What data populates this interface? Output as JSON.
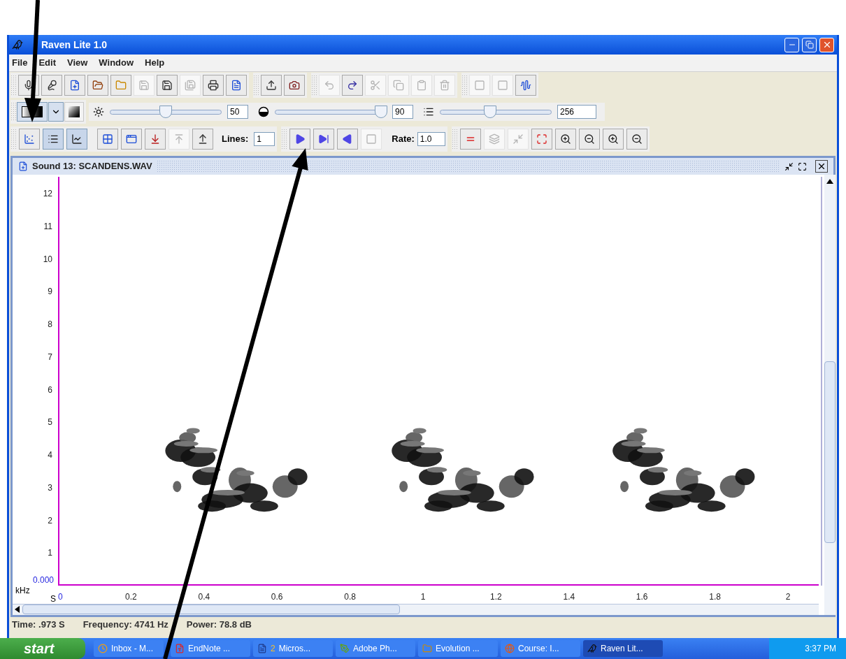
{
  "window": {
    "title": "Raven Lite 1.0"
  },
  "menu": [
    {
      "label": "File"
    },
    {
      "label": "Edit"
    },
    {
      "label": "View"
    },
    {
      "label": "Window"
    },
    {
      "label": "Help"
    }
  ],
  "file_toolbar": [
    [
      {
        "kind": "mic",
        "disabled": false
      },
      {
        "kind": "mics",
        "disabled": false
      },
      {
        "kind": "new",
        "disabled": false
      },
      {
        "kind": "open",
        "disabled": false
      },
      {
        "kind": "folder",
        "disabled": false
      },
      {
        "kind": "save",
        "disabled": true
      },
      {
        "kind": "saveas",
        "disabled": false
      },
      {
        "kind": "saveall",
        "disabled": true
      },
      {
        "kind": "print",
        "disabled": false
      },
      {
        "kind": "page",
        "disabled": false
      }
    ],
    [
      {
        "kind": "export",
        "disabled": false
      },
      {
        "kind": "snapshot",
        "disabled": false
      }
    ],
    [
      {
        "kind": "undo",
        "disabled": true
      },
      {
        "kind": "redo",
        "disabled": false
      },
      {
        "kind": "cut",
        "disabled": true
      },
      {
        "kind": "copy",
        "disabled": true
      },
      {
        "kind": "paste",
        "disabled": true
      },
      {
        "kind": "delete",
        "disabled": true
      }
    ],
    [
      {
        "kind": "square",
        "disabled": true
      },
      {
        "kind": "square",
        "disabled": true
      },
      {
        "kind": "wave",
        "disabled": false
      }
    ]
  ],
  "display_toolbar": {
    "sliders": [
      {
        "kind": "brightness",
        "level": 0.5,
        "value": "50"
      },
      {
        "kind": "contrast",
        "level": 0.95,
        "value": "90"
      },
      {
        "kind": "size",
        "level": 0.45,
        "value": "256"
      }
    ]
  },
  "view_toolbar": {
    "views": [
      {
        "kind": "spectrogram",
        "selected": false
      },
      {
        "kind": "lines",
        "selected": true
      },
      {
        "kind": "axis",
        "selected": true
      }
    ],
    "layout": [
      {
        "kind": "grid",
        "disabled": false
      },
      {
        "kind": "windows",
        "disabled": false
      },
      {
        "kind": "down",
        "disabled": false
      },
      {
        "kind": "up",
        "disabled": true
      },
      {
        "kind": "uptop",
        "disabled": false
      }
    ],
    "lines_label": "Lines:",
    "lines_value": "1",
    "playback": [
      {
        "kind": "play",
        "disabled": false
      },
      {
        "kind": "playnext",
        "disabled": false
      },
      {
        "kind": "reverse",
        "disabled": false
      },
      {
        "kind": "stop",
        "disabled": true
      }
    ],
    "rate_label": "Rate:",
    "rate_value": "1.0",
    "zoom": [
      {
        "kind": "equal",
        "disabled": false
      },
      {
        "kind": "fold",
        "disabled": true
      },
      {
        "kind": "shrink",
        "disabled": true
      },
      {
        "kind": "fit",
        "disabled": false
      },
      {
        "kind": "zoomin",
        "disabled": false
      },
      {
        "kind": "zoomout",
        "disabled": false
      },
      {
        "kind": "zoomin",
        "disabled": false
      },
      {
        "kind": "zoomout",
        "disabled": false
      }
    ]
  },
  "sound_window": {
    "title": "Sound 13: SCANDENS.WAV",
    "y_ticks": [
      "12",
      "11",
      "10",
      "9",
      "8",
      "7",
      "6",
      "5",
      "4",
      "3",
      "2",
      "1"
    ],
    "y_origin": "0.000",
    "y_unit": "kHz",
    "x_unit": "S",
    "x_ticks": [
      "0",
      "0.2",
      "0.4",
      "0.6",
      "0.8",
      "1",
      "1.2",
      "1.4",
      "1.6",
      "1.8",
      "2"
    ]
  },
  "status_bar": [
    {
      "label": "Time:",
      "value": ".973 S"
    },
    {
      "label": "Frequency:",
      "value": "4741 Hz"
    },
    {
      "label": "Power:",
      "value": "78.8 dB"
    }
  ],
  "taskbar": {
    "start": "start",
    "items": [
      {
        "kind": "clock",
        "label": "Inbox - M...",
        "selected": false
      },
      {
        "kind": "endnote",
        "label": "EndNote ...",
        "selected": false
      },
      {
        "kind": "word",
        "count": "2",
        "label": "Micros...",
        "selected": false
      },
      {
        "kind": "brush",
        "label": "Adobe Ph...",
        "selected": false
      },
      {
        "kind": "folder",
        "label": "Evolution ...",
        "selected": false
      },
      {
        "kind": "firefox",
        "label": "Course: I...",
        "selected": false
      },
      {
        "kind": "raven",
        "label": "Raven Lit...",
        "selected": true
      }
    ],
    "time": "3:37 PM"
  }
}
